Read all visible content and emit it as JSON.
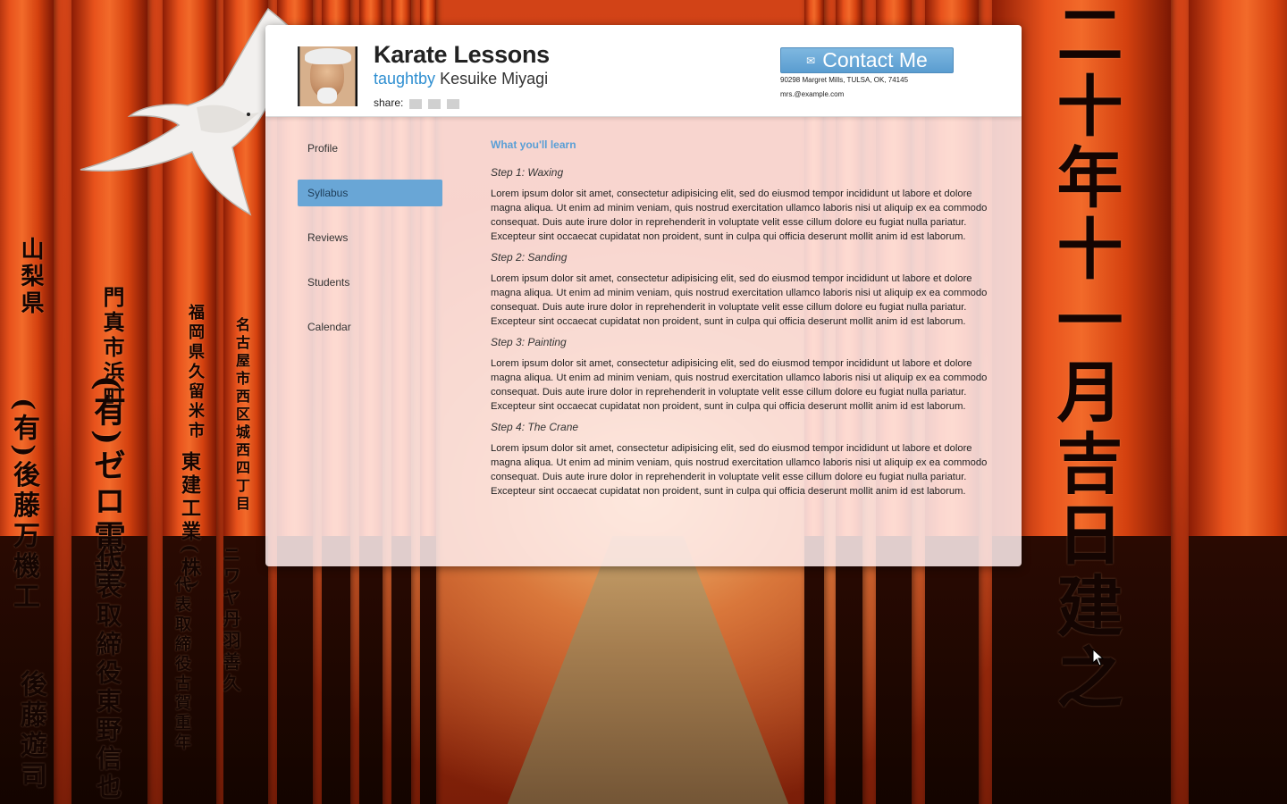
{
  "colors": {
    "accent": "#5a9dd0",
    "link": "#2f8fd1",
    "active_nav": "#69a6d6",
    "card_body": "#ffeeee"
  },
  "background": {
    "kanji_columns": [
      "二十年十一月吉日建之",
      "山梨県",
      "門真市浜町",
      "(有)ゼロ電設",
      "代表取締役東野信也",
      "(有)後藤万機工",
      "後藤遊司",
      "福岡県久留米市",
      "東建工業(株)",
      "代表取締役古賀重年",
      "名古屋市西区城西四丁目",
      "ニワヤ丹羽善久"
    ]
  },
  "header": {
    "title": "Karate Lessons",
    "taught_label": "taughtby",
    "teacher_name": "Kesuike Miyagi",
    "share_label": "share:",
    "share_icons": [
      "share-icon-1",
      "share-icon-2",
      "share-icon-3"
    ],
    "contact_button_label": "Contact Me",
    "contact_icon_glyph": "✉",
    "address": "90298 Margret Mills, TULSA, OK, 74145",
    "email": "mrs.@example.com"
  },
  "nav": {
    "items": [
      {
        "label": "Profile",
        "active": false
      },
      {
        "label": "Syllabus",
        "active": true
      },
      {
        "label": "Reviews",
        "active": false
      },
      {
        "label": "Students",
        "active": false
      },
      {
        "label": "Calendar",
        "active": false
      }
    ]
  },
  "content": {
    "heading": "What you'll learn",
    "steps": [
      {
        "title": "Step 1: Waxing",
        "text": "Lorem ipsum dolor sit amet, consectetur adipisicing elit, sed do eiusmod tempor incididunt ut labore et dolore magna aliqua. Ut enim ad minim veniam, quis nostrud exercitation ullamco laboris nisi ut aliquip ex ea commodo consequat. Duis aute irure dolor in reprehenderit in voluptate velit esse cillum dolore eu fugiat nulla pariatur. Excepteur sint occaecat cupidatat non proident, sunt in culpa qui officia deserunt mollit anim id est laborum."
      },
      {
        "title": "Step 2: Sanding",
        "text": "Lorem ipsum dolor sit amet, consectetur adipisicing elit, sed do eiusmod tempor incididunt ut labore et dolore magna aliqua. Ut enim ad minim veniam, quis nostrud exercitation ullamco laboris nisi ut aliquip ex ea commodo consequat. Duis aute irure dolor in reprehenderit in voluptate velit esse cillum dolore eu fugiat nulla pariatur. Excepteur sint occaecat cupidatat non proident, sunt in culpa qui officia deserunt mollit anim id est laborum."
      },
      {
        "title": "Step 3: Painting",
        "text": "Lorem ipsum dolor sit amet, consectetur adipisicing elit, sed do eiusmod tempor incididunt ut labore et dolore magna aliqua. Ut enim ad minim veniam, quis nostrud exercitation ullamco laboris nisi ut aliquip ex ea commodo consequat. Duis aute irure dolor in reprehenderit in voluptate velit esse cillum dolore eu fugiat nulla pariatur. Excepteur sint occaecat cupidatat non proident, sunt in culpa qui officia deserunt mollit anim id est laborum."
      },
      {
        "title": "Step 4: The Crane",
        "text": "Lorem ipsum dolor sit amet, consectetur adipisicing elit, sed do eiusmod tempor incididunt ut labore et dolore magna aliqua. Ut enim ad minim veniam, quis nostrud exercitation ullamco laboris nisi ut aliquip ex ea commodo consequat. Duis aute irure dolor in reprehenderit in voluptate velit esse cillum dolore eu fugiat nulla pariatur. Excepteur sint occaecat cupidatat non proident, sunt in culpa qui officia deserunt mollit anim id est laborum."
      }
    ]
  }
}
